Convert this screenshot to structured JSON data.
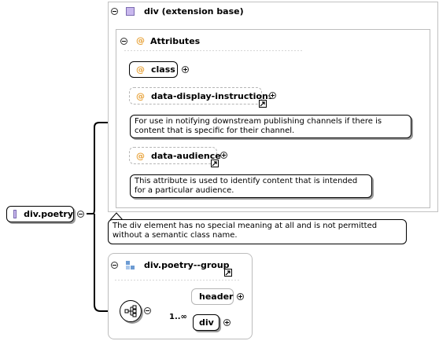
{
  "root": {
    "label": "div.poetry"
  },
  "extension": {
    "title": "div (extension base)"
  },
  "attributes": {
    "title": "Attributes",
    "items": [
      {
        "name": "class"
      },
      {
        "name": "data-display-instructions",
        "note": "For use in notifying downstream publishing channels if there is content that is specific for their channel."
      },
      {
        "name": "data-audience",
        "note": "This attribute is used to identify content that is intended for a particular audience."
      }
    ]
  },
  "extension_note": "The div element has no special meaning at all and is not permitted without a semantic class name.",
  "group": {
    "title": "div.poetry--group",
    "children": [
      {
        "name": "header"
      },
      {
        "name": "div",
        "cardinality": "1..∞"
      }
    ]
  },
  "colors": {
    "attribute_at": "#e8a33b",
    "element_icon": "#c9b8ee",
    "group_icon": "#6c9bd3"
  }
}
